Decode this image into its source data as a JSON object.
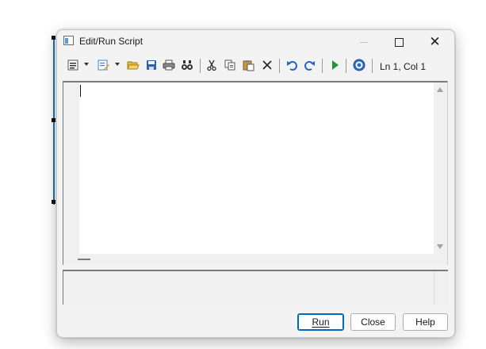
{
  "window": {
    "title": "Edit/Run Script"
  },
  "toolbar": {
    "items": [
      {
        "name": "format-icon"
      },
      {
        "name": "edit-icon"
      },
      {
        "name": "open-folder-icon"
      },
      {
        "name": "save-icon"
      },
      {
        "name": "print-icon"
      },
      {
        "name": "find-icon"
      },
      {
        "name": "cut-icon"
      },
      {
        "name": "copy-icon"
      },
      {
        "name": "paste-icon"
      },
      {
        "name": "delete-icon"
      },
      {
        "name": "undo-icon"
      },
      {
        "name": "redo-icon"
      },
      {
        "name": "run-icon"
      },
      {
        "name": "help-icon"
      }
    ],
    "cursor_position": "Ln 1, Col 1"
  },
  "editor": {
    "content": ""
  },
  "output": {
    "content": ""
  },
  "buttons": {
    "run": "Run",
    "close": "Close",
    "help": "Help"
  },
  "colors": {
    "accent": "#0067c0",
    "window_bg": "#f3f3f3",
    "editor_bg": "#ffffff"
  }
}
